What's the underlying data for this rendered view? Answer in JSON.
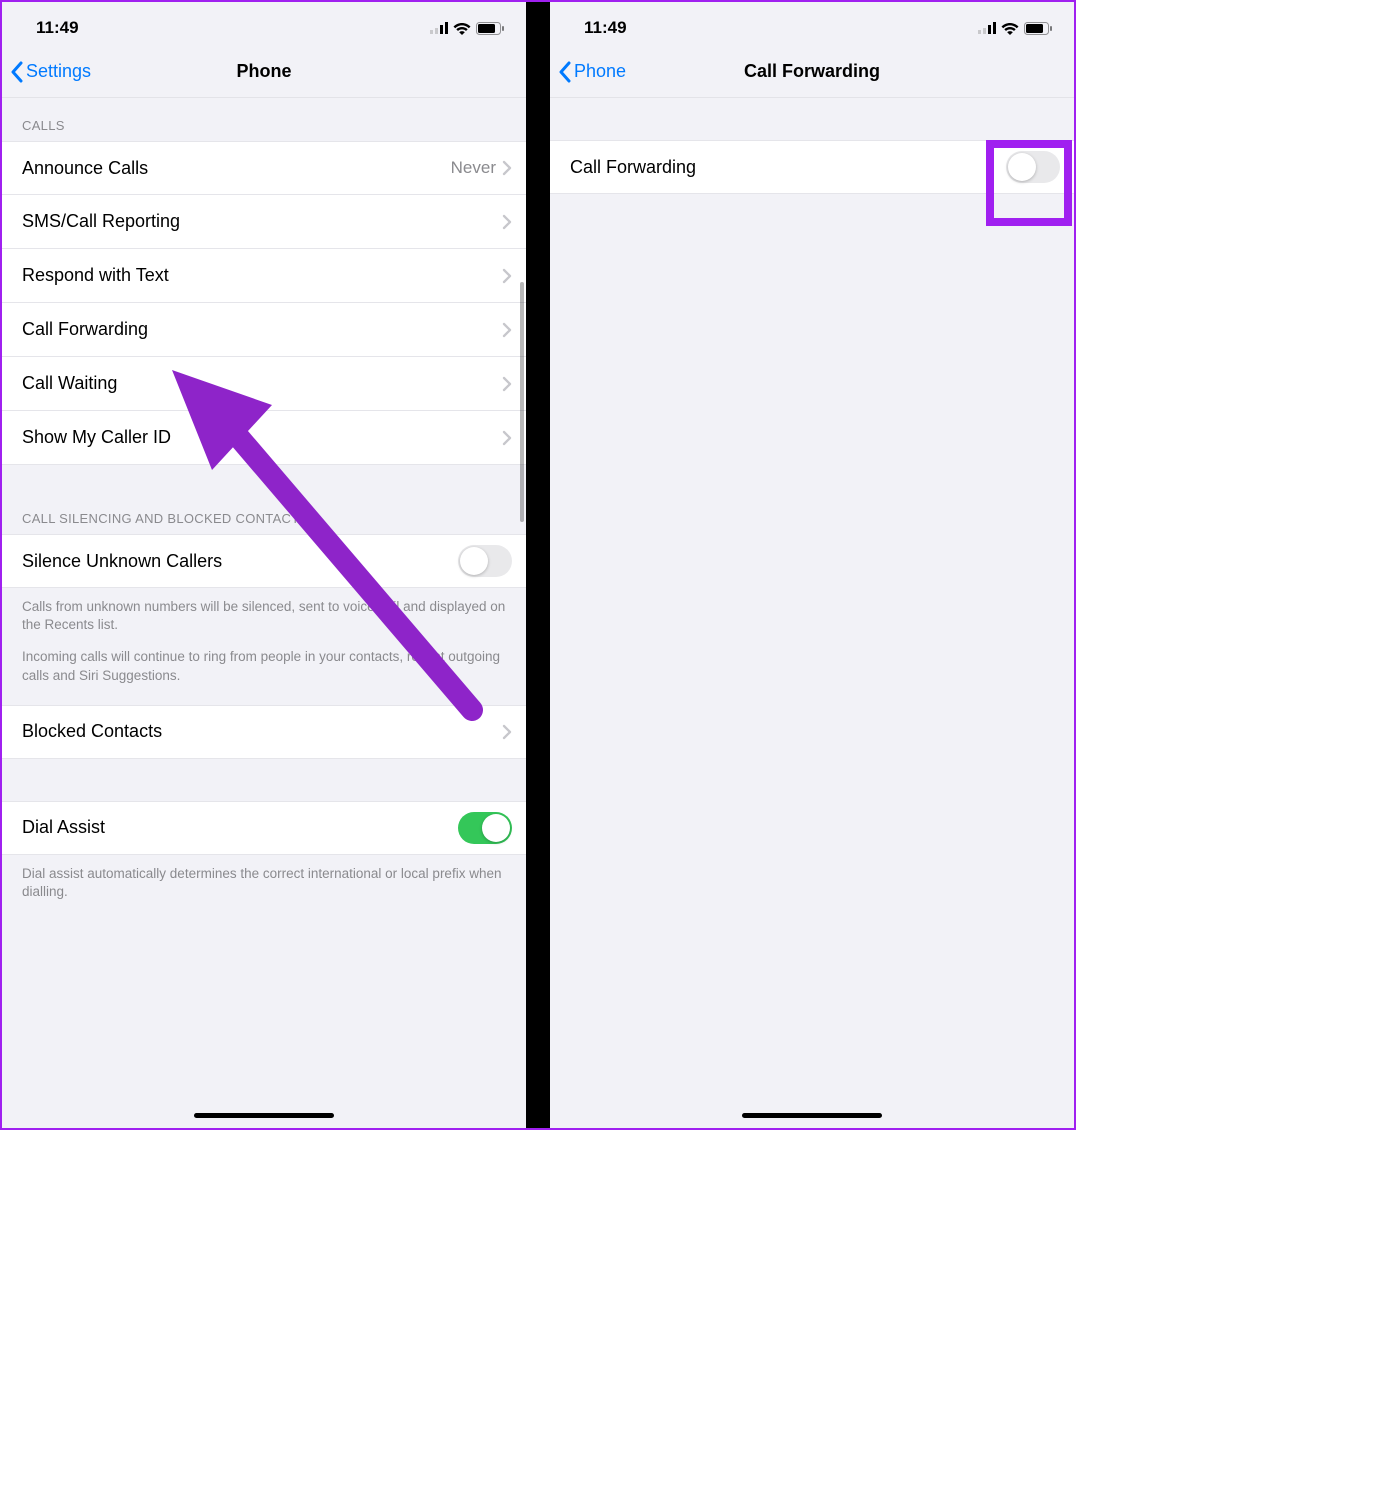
{
  "status": {
    "time": "11:49"
  },
  "left": {
    "back_label": "Settings",
    "title": "Phone",
    "calls_header": "CALLS",
    "calls_items": {
      "announce": {
        "label": "Announce Calls",
        "value": "Never"
      },
      "sms": {
        "label": "SMS/Call Reporting"
      },
      "respond": {
        "label": "Respond with Text"
      },
      "forwarding": {
        "label": "Call Forwarding"
      },
      "waiting": {
        "label": "Call Waiting"
      },
      "callerid": {
        "label": "Show My Caller ID"
      }
    },
    "silencing_header": "CALL SILENCING AND BLOCKED CONTACTS",
    "silence_unknown": {
      "label": "Silence Unknown Callers",
      "on": false
    },
    "silence_footer_1": "Calls from unknown numbers will be silenced, sent to voicemail and displayed on the Recents list.",
    "silence_footer_2": "Incoming calls will continue to ring from people in your contacts, recent outgoing calls and Siri Suggestions.",
    "blocked": {
      "label": "Blocked Contacts"
    },
    "dial_assist": {
      "label": "Dial Assist",
      "on": true
    },
    "dial_assist_footer": "Dial assist automatically determines the correct international or local prefix when dialling."
  },
  "right": {
    "back_label": "Phone",
    "title": "Call Forwarding",
    "row": {
      "label": "Call Forwarding",
      "on": false
    }
  }
}
